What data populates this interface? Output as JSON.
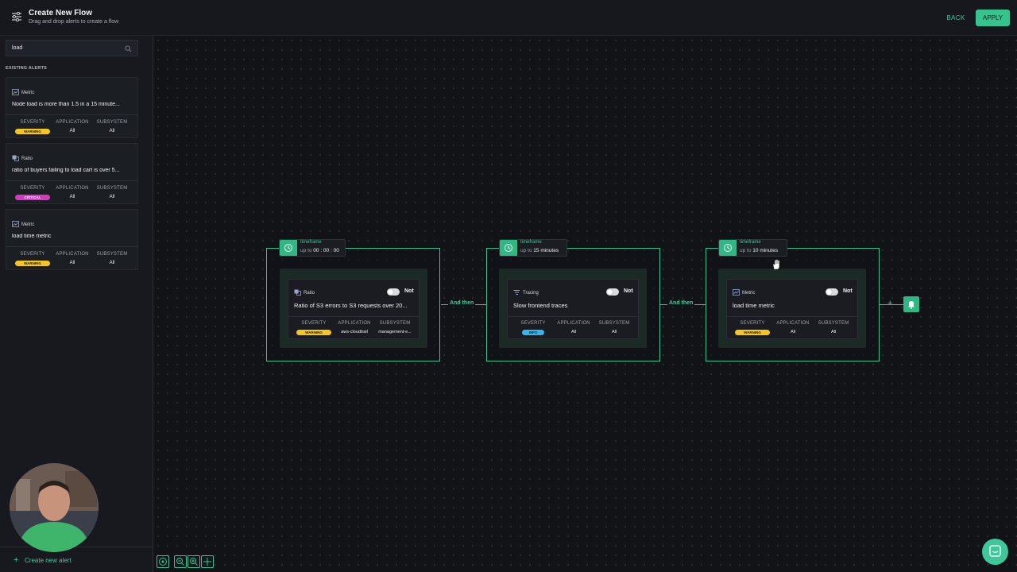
{
  "header": {
    "title": "Create New Flow",
    "subtitle": "Drag and drop alerts to create a flow",
    "back_label": "BACK",
    "apply_label": "APPLY"
  },
  "sidebar": {
    "search_value": "load",
    "section_label": "EXISTING ALERTS",
    "columns": {
      "severity": "SEVERITY",
      "application": "APPLICATION",
      "subsystem": "SUBSYSTEM"
    },
    "alerts": [
      {
        "type": "Metric",
        "name": "Node load is more than 1.5 in a 15 minute...",
        "severity": "WARNING",
        "application": "All",
        "subsystem": "All"
      },
      {
        "type": "Ratio",
        "name": "ratio of buyers failing to load cart is over 5...",
        "severity": "CRITICAL",
        "application": "All",
        "subsystem": "All"
      },
      {
        "type": "Metric",
        "name": "load time metric",
        "severity": "WARNING",
        "application": "All",
        "subsystem": "All"
      }
    ],
    "create_label": "Create new alert"
  },
  "flow": {
    "link_label": "And then",
    "timeframe_label": "timeframe",
    "up_to": "up to",
    "groups": [
      {
        "timeframe": "00 : 00 : 00",
        "node": {
          "type": "Ratio",
          "not_label": "Not",
          "name": "Ratio of S3 errors to S3 requests over 20...",
          "severity": "WARNING",
          "application": "aws-cloudtrail",
          "subsystem": "management-e..."
        }
      },
      {
        "timeframe": "15 minutes",
        "node": {
          "type": "Tracing",
          "not_label": "Not",
          "name": "Slow frontend traces",
          "severity": "INFO",
          "application": "All",
          "subsystem": "All"
        }
      },
      {
        "timeframe": "10 minutes",
        "node": {
          "type": "Metric",
          "not_label": "Not",
          "name": "load time metric",
          "severity": "WARNING",
          "application": "All",
          "subsystem": "All"
        }
      }
    ]
  },
  "colors": {
    "accent": "#36c48e",
    "warning": "#f3c623",
    "critical": "#d13bbf",
    "info": "#35b5e8"
  },
  "icons": [
    "filter-settings-icon",
    "search-icon",
    "metric-icon",
    "ratio-icon",
    "tracing-icon",
    "clock-icon",
    "bell-icon",
    "plus-icon",
    "fit-view-icon",
    "zoom-out-icon",
    "zoom-in-icon",
    "move-icon",
    "chat-icon"
  ]
}
